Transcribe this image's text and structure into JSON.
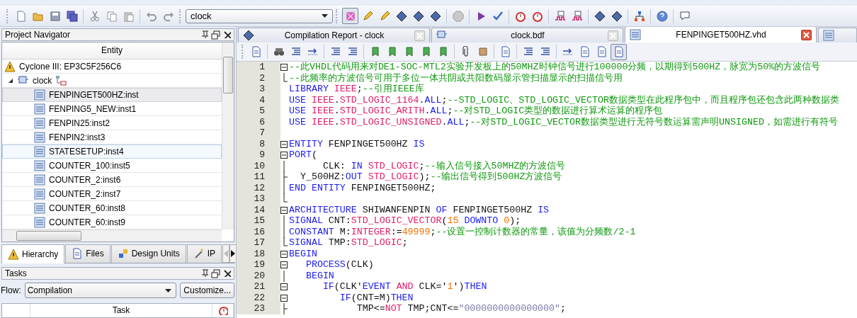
{
  "toolbar": {
    "project_combo": "clock"
  },
  "navigator": {
    "title": "Project Navigator",
    "column": "Entity",
    "device": "Cyclone III: EP3C5F256C6",
    "root": {
      "label": "clock",
      "expanded": true,
      "children": [
        {
          "label": "FENPINGET500HZ:inst",
          "selected": true,
          "hovered": false
        },
        {
          "label": "FENPING5_NEW:inst1",
          "selected": false,
          "hovered": false
        },
        {
          "label": "FENPIN25:inst2",
          "selected": false,
          "hovered": false
        },
        {
          "label": "FENPIN2:inst3",
          "selected": false,
          "hovered": false
        },
        {
          "label": "STATESETUP:inst4",
          "selected": false,
          "hovered": true
        },
        {
          "label": "COUNTER_100:inst5",
          "selected": false,
          "hovered": false
        },
        {
          "label": "COUNTER_2:inst6",
          "selected": false,
          "hovered": false
        },
        {
          "label": "COUNTER_2:inst7",
          "selected": false,
          "hovered": false
        },
        {
          "label": "COUNTER_60:inst8",
          "selected": false,
          "hovered": false
        },
        {
          "label": "COUNTER_60:inst9",
          "selected": false,
          "hovered": false
        }
      ]
    },
    "tabs": [
      {
        "label": "Hierarchy",
        "selected": true
      },
      {
        "label": "Files",
        "selected": false
      },
      {
        "label": "Design Units",
        "selected": false
      },
      {
        "label": "IP",
        "selected": false
      }
    ]
  },
  "tasks": {
    "title": "Tasks",
    "flow_label": "Flow:",
    "flow": "Compilation",
    "customize": "Customize...",
    "column": "Task"
  },
  "editor_tabs": [
    {
      "label": "Compilation Report - clock",
      "selected": false,
      "kind": "report"
    },
    {
      "label": "clock.bdf",
      "selected": false,
      "kind": "bdf"
    },
    {
      "label": "FENPINGET500HZ.vhd",
      "selected": true,
      "kind": "vhd"
    },
    {
      "selected": false,
      "kind": "vhd"
    }
  ],
  "code": [
    {
      "number": "1",
      "kind": "start",
      "tokens": [
        {
          "kind": "comment",
          "text": "--此VHDL代码用来对DE1-SOC-MTL2实验开发板上的50MHZ时钟信号进行100000分频，以期得到500HZ，脉宽为50%的方波信号"
        }
      ]
    },
    {
      "number": "2",
      "kind": "end",
      "tokens": [
        {
          "kind": "comment",
          "text": "--此频率的方波信号可用于多位一体共阴或共阳数码显示管扫描显示的扫描信号用"
        }
      ]
    },
    {
      "number": "3",
      "kind": "plain",
      "tokens": [
        {
          "kind": "keyword",
          "text": "LIBRARY "
        },
        {
          "kind": "type",
          "text": "IEEE"
        },
        {
          "kind": "plain",
          "text": ";"
        },
        {
          "kind": "comment",
          "text": "--引用IEEE库"
        }
      ]
    },
    {
      "number": "4",
      "kind": "plain",
      "tokens": [
        {
          "kind": "keyword",
          "text": "USE "
        },
        {
          "kind": "type",
          "text": "IEEE"
        },
        {
          "kind": "plain",
          "text": "."
        },
        {
          "kind": "type",
          "text": "STD_LOGIC_1164"
        },
        {
          "kind": "plain",
          "text": "."
        },
        {
          "kind": "keyword",
          "text": "ALL"
        },
        {
          "kind": "plain",
          "text": ";"
        },
        {
          "kind": "comment",
          "text": "--STD_LOGIC、STD_LOGIC_VECTOR数据类型在此程序包中，而且程序包还包含此两种数据类"
        }
      ]
    },
    {
      "number": "5",
      "kind": "plain",
      "tokens": [
        {
          "kind": "keyword",
          "text": "USE "
        },
        {
          "kind": "type",
          "text": "IEEE"
        },
        {
          "kind": "plain",
          "text": "."
        },
        {
          "kind": "type",
          "text": "STD_LOGIC_ARITH"
        },
        {
          "kind": "plain",
          "text": "."
        },
        {
          "kind": "keyword",
          "text": "ALL"
        },
        {
          "kind": "plain",
          "text": ";"
        },
        {
          "kind": "comment",
          "text": "--对STD_LOGIC类型的数据进行算术运算的程序包"
        }
      ]
    },
    {
      "number": "6",
      "kind": "plain",
      "tokens": [
        {
          "kind": "keyword",
          "text": "USE "
        },
        {
          "kind": "type",
          "text": "IEEE"
        },
        {
          "kind": "plain",
          "text": "."
        },
        {
          "kind": "type",
          "text": "STD_LOGIC_UNSIGNED"
        },
        {
          "kind": "plain",
          "text": "."
        },
        {
          "kind": "keyword",
          "text": "ALL"
        },
        {
          "kind": "plain",
          "text": ";"
        },
        {
          "kind": "comment",
          "text": "--对STD_LOGIC_VECTOR数据类型进行无符号数运算需声明UNSIGNED，如需进行有符号"
        }
      ]
    },
    {
      "number": "7",
      "kind": "plain"
    },
    {
      "number": "8",
      "kind": "start",
      "tokens": [
        {
          "kind": "keyword",
          "text": "ENTITY"
        },
        {
          "kind": "plain",
          "text": " FENPINGET500HZ "
        },
        {
          "kind": "keyword",
          "text": "IS"
        }
      ]
    },
    {
      "number": "9",
      "kind": "start",
      "tokens": [
        {
          "kind": "keyword",
          "text": "PORT"
        },
        {
          "kind": "plain",
          "text": "("
        }
      ]
    },
    {
      "number": "10",
      "kind": "line",
      "tokens": [
        {
          "kind": "plain",
          "text": "      CLK: "
        },
        {
          "kind": "keyword",
          "text": "IN "
        },
        {
          "kind": "type",
          "text": "STD_LOGIC"
        },
        {
          "kind": "plain",
          "text": ";"
        },
        {
          "kind": "comment",
          "text": "--输入信号接入50MHZ的方波信号"
        }
      ]
    },
    {
      "number": "11",
      "kind": "branch",
      "tokens": [
        {
          "kind": "plain",
          "text": "  Y_500HZ:"
        },
        {
          "kind": "keyword",
          "text": "OUT "
        },
        {
          "kind": "type",
          "text": "STD_LOGIC"
        },
        {
          "kind": "plain",
          "text": ");"
        },
        {
          "kind": "comment",
          "text": "--输出信号得到500HZ方波信号"
        }
      ]
    },
    {
      "number": "12",
      "kind": "line",
      "tokens": [
        {
          "kind": "keyword",
          "text": "END ENTITY"
        },
        {
          "kind": "plain",
          "text": " FENPINGET500HZ;"
        }
      ]
    },
    {
      "number": "13",
      "kind": "end"
    },
    {
      "number": "14",
      "kind": "start",
      "tokens": [
        {
          "kind": "keyword",
          "text": "ARCHITECTURE"
        },
        {
          "kind": "plain",
          "text": " SHIWANFENPIN "
        },
        {
          "kind": "keyword",
          "text": "OF"
        },
        {
          "kind": "plain",
          "text": " FENPINGET500HZ "
        },
        {
          "kind": "keyword",
          "text": "IS"
        }
      ]
    },
    {
      "number": "15",
      "kind": "line",
      "tokens": [
        {
          "kind": "keyword",
          "text": "SIGNAL"
        },
        {
          "kind": "plain",
          "text": " CNT:"
        },
        {
          "kind": "type",
          "text": "STD_LOGIC_VECTOR"
        },
        {
          "kind": "plain",
          "text": "("
        },
        {
          "kind": "number",
          "text": "15"
        },
        {
          "kind": "keyword",
          "text": " DOWNTO "
        },
        {
          "kind": "number",
          "text": "0"
        },
        {
          "kind": "plain",
          "text": ");"
        }
      ]
    },
    {
      "number": "16",
      "kind": "line",
      "tokens": [
        {
          "kind": "keyword",
          "text": "CONSTANT"
        },
        {
          "kind": "plain",
          "text": " M:"
        },
        {
          "kind": "type",
          "text": "INTEGER"
        },
        {
          "kind": "plain",
          "text": ":="
        },
        {
          "kind": "number",
          "text": "49999"
        },
        {
          "kind": "plain",
          "text": ";"
        },
        {
          "kind": "comment",
          "text": "--设置一控制计数器的常量，该值为分频数/2-1"
        }
      ]
    },
    {
      "number": "17",
      "kind": "end",
      "tokens": [
        {
          "kind": "keyword",
          "text": "SIGNAL"
        },
        {
          "kind": "plain",
          "text": " TMP:"
        },
        {
          "kind": "type",
          "text": "STD_LOGIC"
        },
        {
          "kind": "plain",
          "text": ";"
        }
      ]
    },
    {
      "number": "18",
      "kind": "start",
      "tokens": [
        {
          "kind": "keyword",
          "text": "BEGIN"
        }
      ]
    },
    {
      "number": "19",
      "kind": "start",
      "tokens": [
        {
          "kind": "keyword",
          "text": "   PROCESS"
        },
        {
          "kind": "plain",
          "text": "(CLK)"
        }
      ]
    },
    {
      "number": "20",
      "kind": "line",
      "tokens": [
        {
          "kind": "keyword",
          "text": "   BEGIN"
        }
      ]
    },
    {
      "number": "21",
      "kind": "start",
      "tokens": [
        {
          "kind": "keyword",
          "text": "      IF"
        },
        {
          "kind": "plain",
          "text": "(CLK'"
        },
        {
          "kind": "keyword",
          "text": "EVENT "
        },
        {
          "kind": "type",
          "text": "AND"
        },
        {
          "kind": "plain",
          "text": " CLK='"
        },
        {
          "kind": "number",
          "text": "1"
        },
        {
          "kind": "plain",
          "text": "')"
        },
        {
          "kind": "keyword",
          "text": "THEN"
        }
      ]
    },
    {
      "number": "22",
      "kind": "start",
      "tokens": [
        {
          "kind": "keyword",
          "text": "         IF"
        },
        {
          "kind": "plain",
          "text": "(CNT=M)"
        },
        {
          "kind": "keyword",
          "text": "THEN"
        }
      ]
    },
    {
      "number": "23",
      "kind": "branch",
      "tokens": [
        {
          "kind": "plain",
          "text": "            TMP<="
        },
        {
          "kind": "type",
          "text": "NOT"
        },
        {
          "kind": "plain",
          "text": " TMP;CNT<="
        },
        {
          "kind": "string",
          "text": "\"0000000000000000\""
        },
        {
          "kind": "plain",
          "text": ";"
        }
      ]
    }
  ]
}
